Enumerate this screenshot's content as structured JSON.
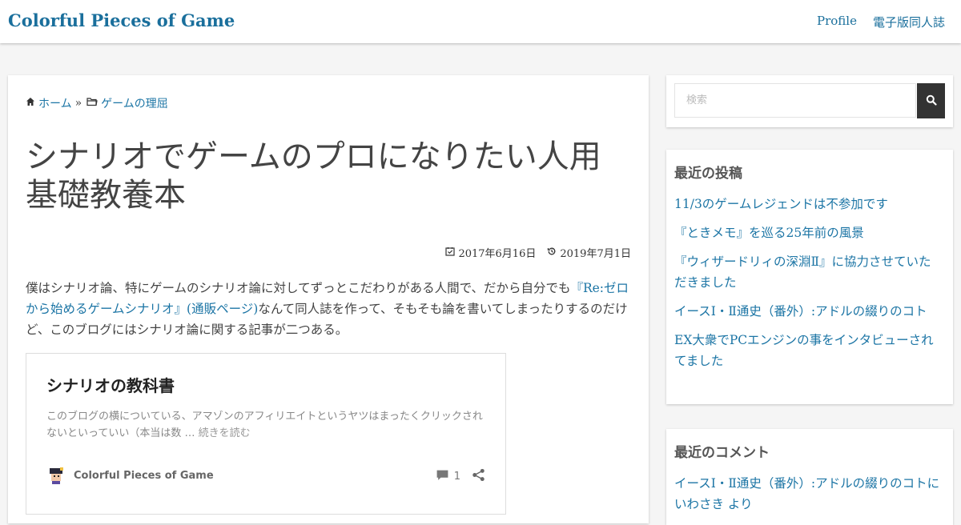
{
  "header": {
    "site_title": "Colorful Pieces of Game",
    "nav": [
      "Profile",
      "電子版同人誌"
    ]
  },
  "breadcrumb": {
    "home": "ホーム",
    "separator": "»",
    "category": "ゲームの理屈"
  },
  "post": {
    "title": "シナリオでゲームのプロになりたい人用基礎教養本",
    "published": "2017年6月16日",
    "updated": "2019年7月1日",
    "body_before_link": "僕はシナリオ論、特にゲームのシナリオ論に対してずっとこだわりがある人間で、だから自分でも",
    "body_link1": "『Re:ゼロから始めるゲームシナリオ』",
    "body_link2": "(通販ページ)",
    "body_after_link": "なんて同人誌を作って、そもそも論を書いてしまったりするのだけど、このブログにはシナリオ論に関する記事が二つある。"
  },
  "embed": {
    "title": "シナリオの教科書",
    "excerpt": "このブログの横についている、アマゾンのアフィリエイトというヤツはまったくクリックされないといっていい（本当は数 …",
    "more": "続きを読む",
    "site_name": "Colorful Pieces of Game",
    "comment_count": "1"
  },
  "sidebar": {
    "search_placeholder": "検索",
    "recent_title": "最近の投稿",
    "recent_posts": [
      "11/3のゲームレジェンドは不参加です",
      "『ときメモ』を巡る25年前の風景",
      "『ウィザードリィの深淵Ⅱ』に協力させていただきました",
      "イースⅠ・Ⅱ通史（番外）:アドルの綴りのコト",
      "EX大衆でPCエンジンの事をインタビューされてました"
    ],
    "comments_title": "最近のコメント",
    "recent_comments": [
      "イースⅠ・Ⅱ通史（番外）:アドルの綴りのコトにいわさき より"
    ]
  },
  "colors": {
    "link": "#1c75a5",
    "title": "#1a6f9c",
    "search_button": "#333333"
  }
}
